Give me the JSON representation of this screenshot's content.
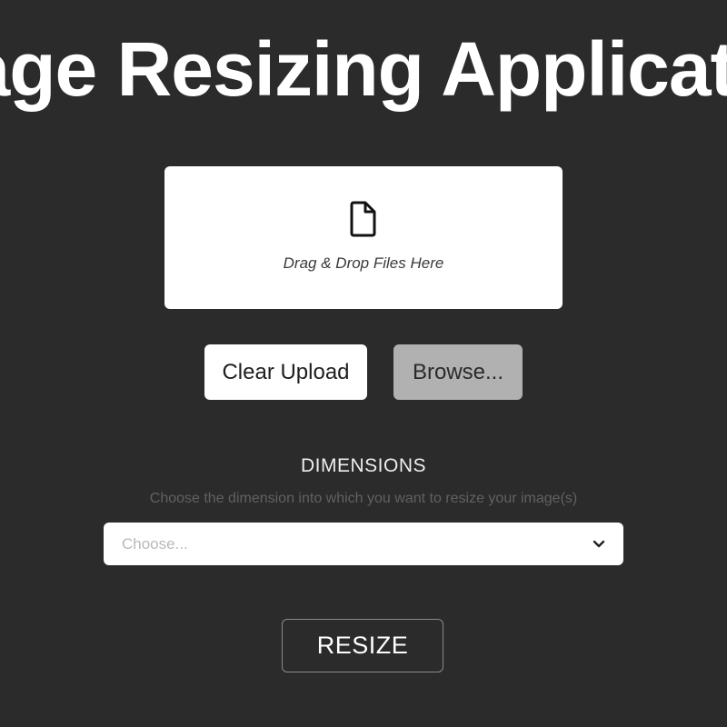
{
  "header": {
    "title": "Image Resizing Application"
  },
  "upload": {
    "icon": "file-icon",
    "drop_text": "Drag & Drop Files Here",
    "clear_label": "Clear Upload",
    "browse_label": "Browse..."
  },
  "dimensions": {
    "label": "DIMENSIONS",
    "help_text": "Choose the dimension into which you want to resize your image(s)",
    "select_placeholder": "Choose...",
    "select_icon": "chevron-down-icon"
  },
  "actions": {
    "resize_label": "RESIZE"
  },
  "colors": {
    "background": "#2b2b2b",
    "surface": "#ffffff",
    "browse_button": "#b1b1b1",
    "help_text": "#616161"
  }
}
